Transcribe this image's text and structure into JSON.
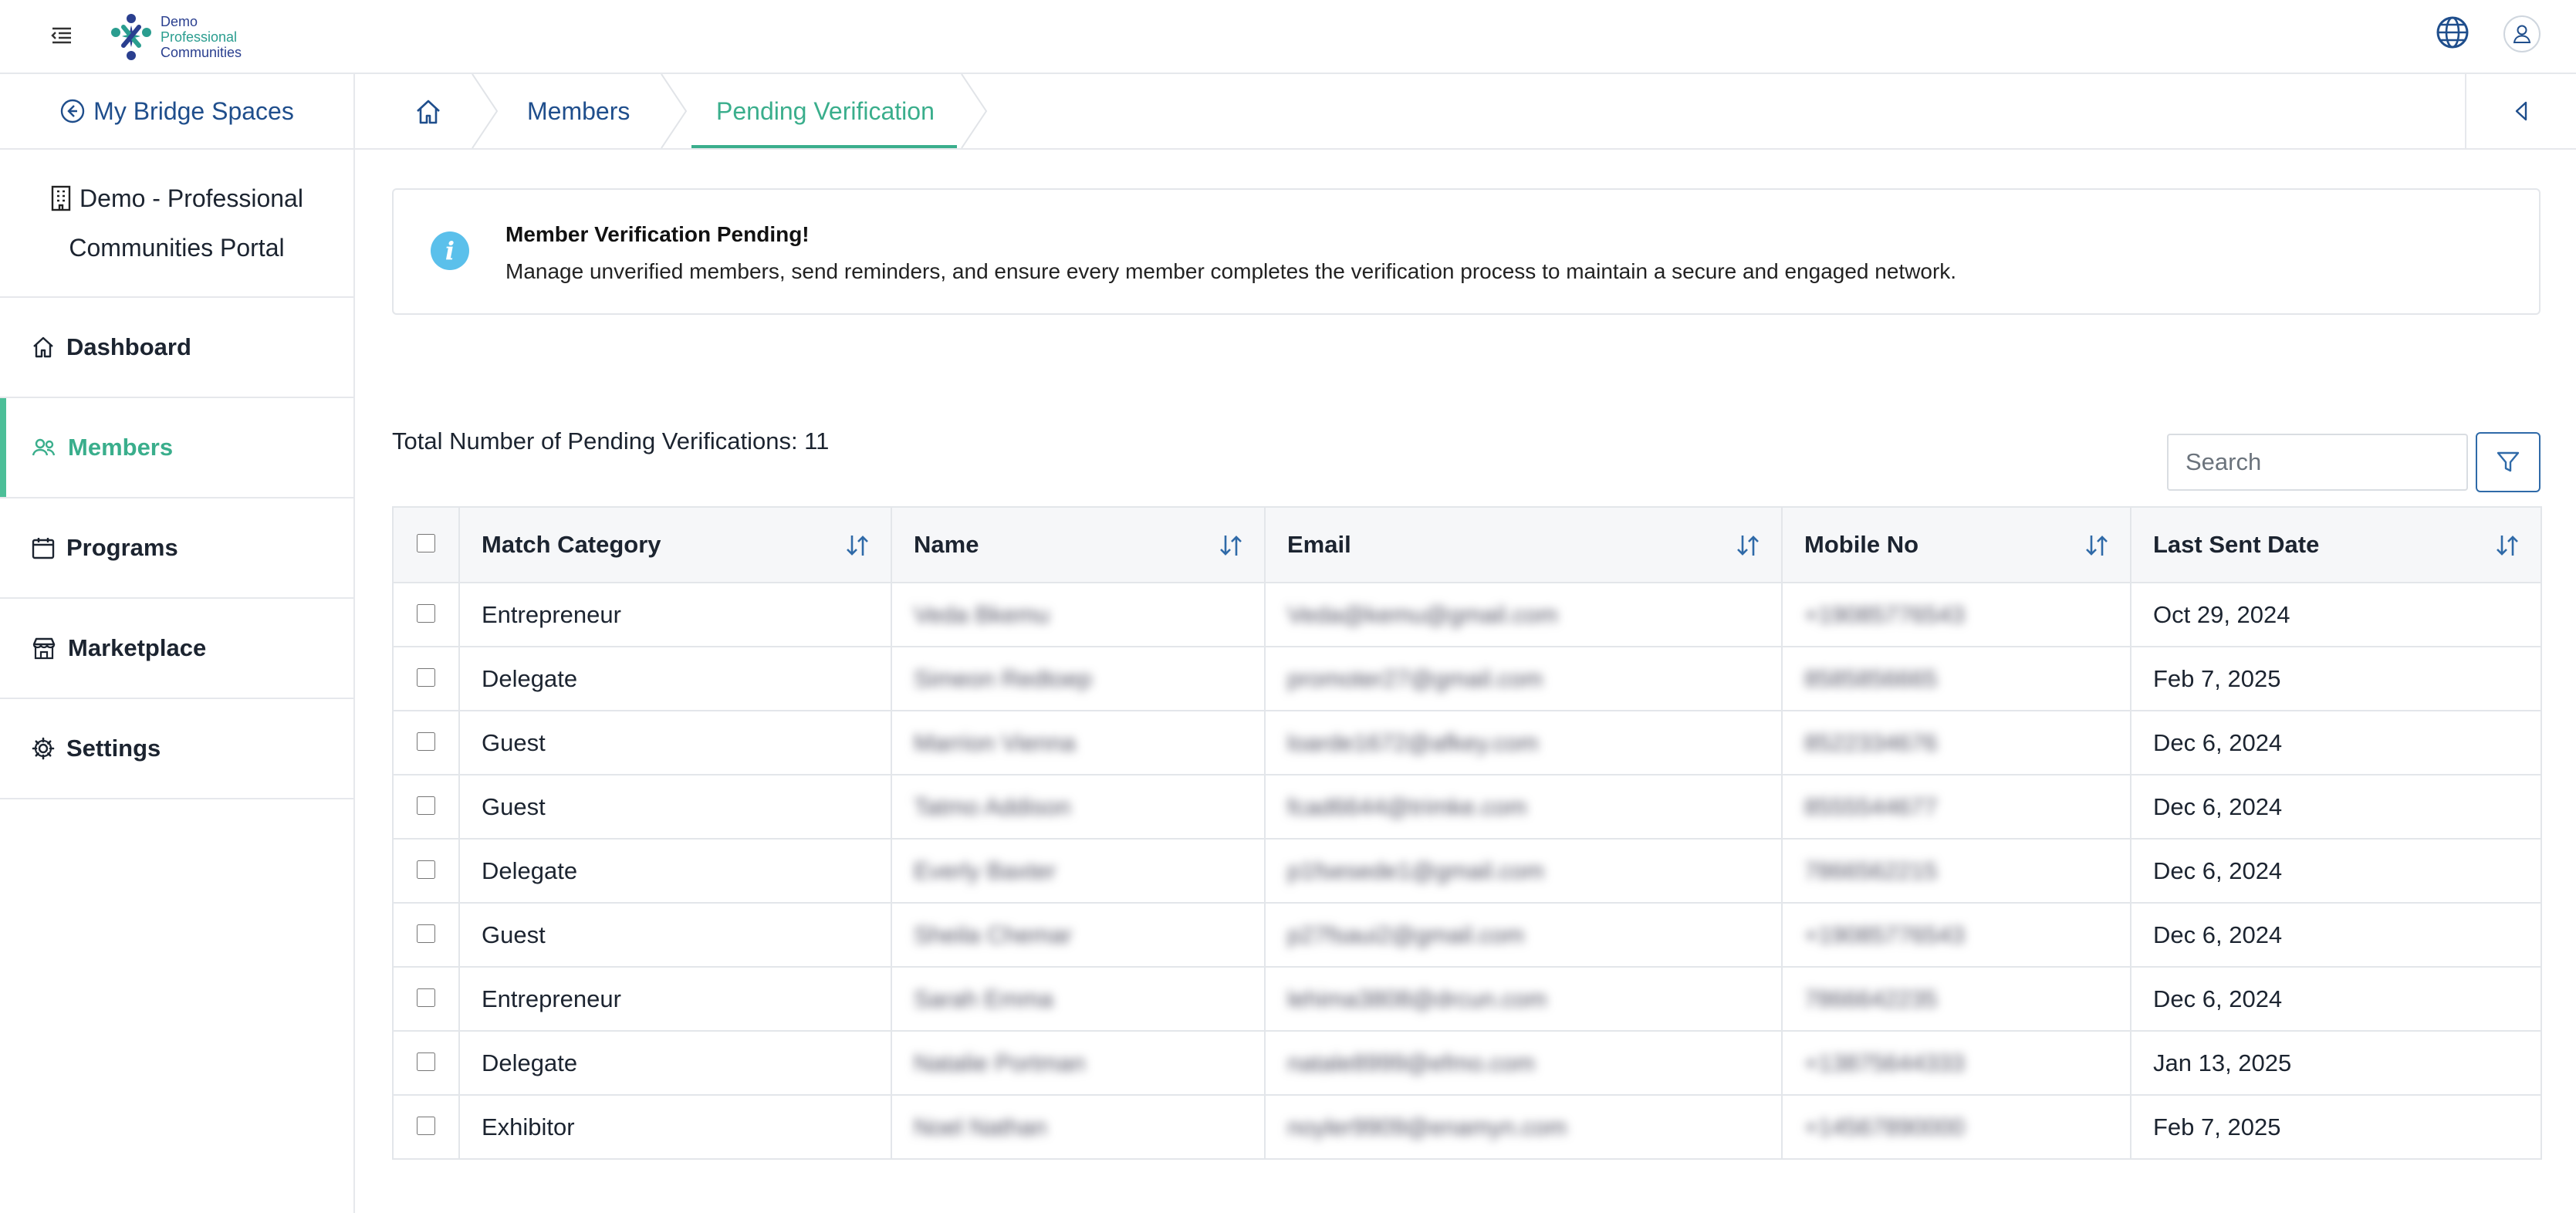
{
  "header": {
    "logo_line1": "Demo",
    "logo_line2": "Professional",
    "logo_line3": "Communities"
  },
  "sidebar": {
    "back_link": "My Bridge Spaces",
    "org_line1": "Demo - Professional",
    "org_line2": "Communities Portal",
    "items": [
      {
        "label": "Dashboard",
        "icon": "home-icon"
      },
      {
        "label": "Members",
        "icon": "users-icon",
        "active": true
      },
      {
        "label": "Programs",
        "icon": "calendar-icon"
      },
      {
        "label": "Marketplace",
        "icon": "store-icon"
      },
      {
        "label": "Settings",
        "icon": "gear-icon"
      }
    ]
  },
  "breadcrumb": {
    "items": [
      "Members",
      "Pending Verification"
    ]
  },
  "info": {
    "title": "Member Verification Pending!",
    "description": "Manage unverified members, send reminders, and ensure every member completes the verification process to maintain a secure and engaged network."
  },
  "toolbar": {
    "total_label": "Total Number of Pending Verifications: 11",
    "search_placeholder": "Search"
  },
  "table": {
    "columns": [
      "Match Category",
      "Name",
      "Email",
      "Mobile No",
      "Last Sent Date"
    ],
    "rows": [
      {
        "category": "Entrepreneur",
        "name": "Veda Bkemu",
        "email": "Veda@kemu@gmail.com",
        "mobile": "+19085776543",
        "date": "Oct 29, 2024"
      },
      {
        "category": "Delegate",
        "name": "Simeon Redtoep",
        "email": "promoter27@gmail.com",
        "mobile": "8585856665",
        "date": "Feb 7, 2025"
      },
      {
        "category": "Guest",
        "name": "Marrion Vienna",
        "email": "loarde1672@afkey.com",
        "mobile": "8522334676",
        "date": "Dec 6, 2024"
      },
      {
        "category": "Guest",
        "name": "Tatmo Addison",
        "email": "fcad6644@trimke.com",
        "mobile": "8555544677",
        "date": "Dec 6, 2024"
      },
      {
        "category": "Delegate",
        "name": "Everly Baxter",
        "email": "p1fsesede1@gmail.com",
        "mobile": "7866562215",
        "date": "Dec 6, 2024"
      },
      {
        "category": "Guest",
        "name": "Sheila Chemar",
        "email": "p27fsaui2@gmail.com",
        "mobile": "+19085776543",
        "date": "Dec 6, 2024"
      },
      {
        "category": "Entrepreneur",
        "name": "Sarah Emma",
        "email": "lehima3808@drcun.com",
        "mobile": "7866642235",
        "date": "Dec 6, 2024"
      },
      {
        "category": "Delegate",
        "name": "Natalie Portman",
        "email": "natale8999@efmo.com",
        "mobile": "+13875644333",
        "date": "Jan 13, 2025"
      },
      {
        "category": "Exhibitor",
        "name": "Noel Nathan",
        "email": "noyler9909@enamyn.com",
        "mobile": "+14567890000",
        "date": "Feb 7, 2025"
      }
    ]
  },
  "colors": {
    "accent": "#3aae8c",
    "link": "#1f4e8c",
    "info_icon": "#5bc0eb",
    "filter_border": "#2f6aa8"
  }
}
